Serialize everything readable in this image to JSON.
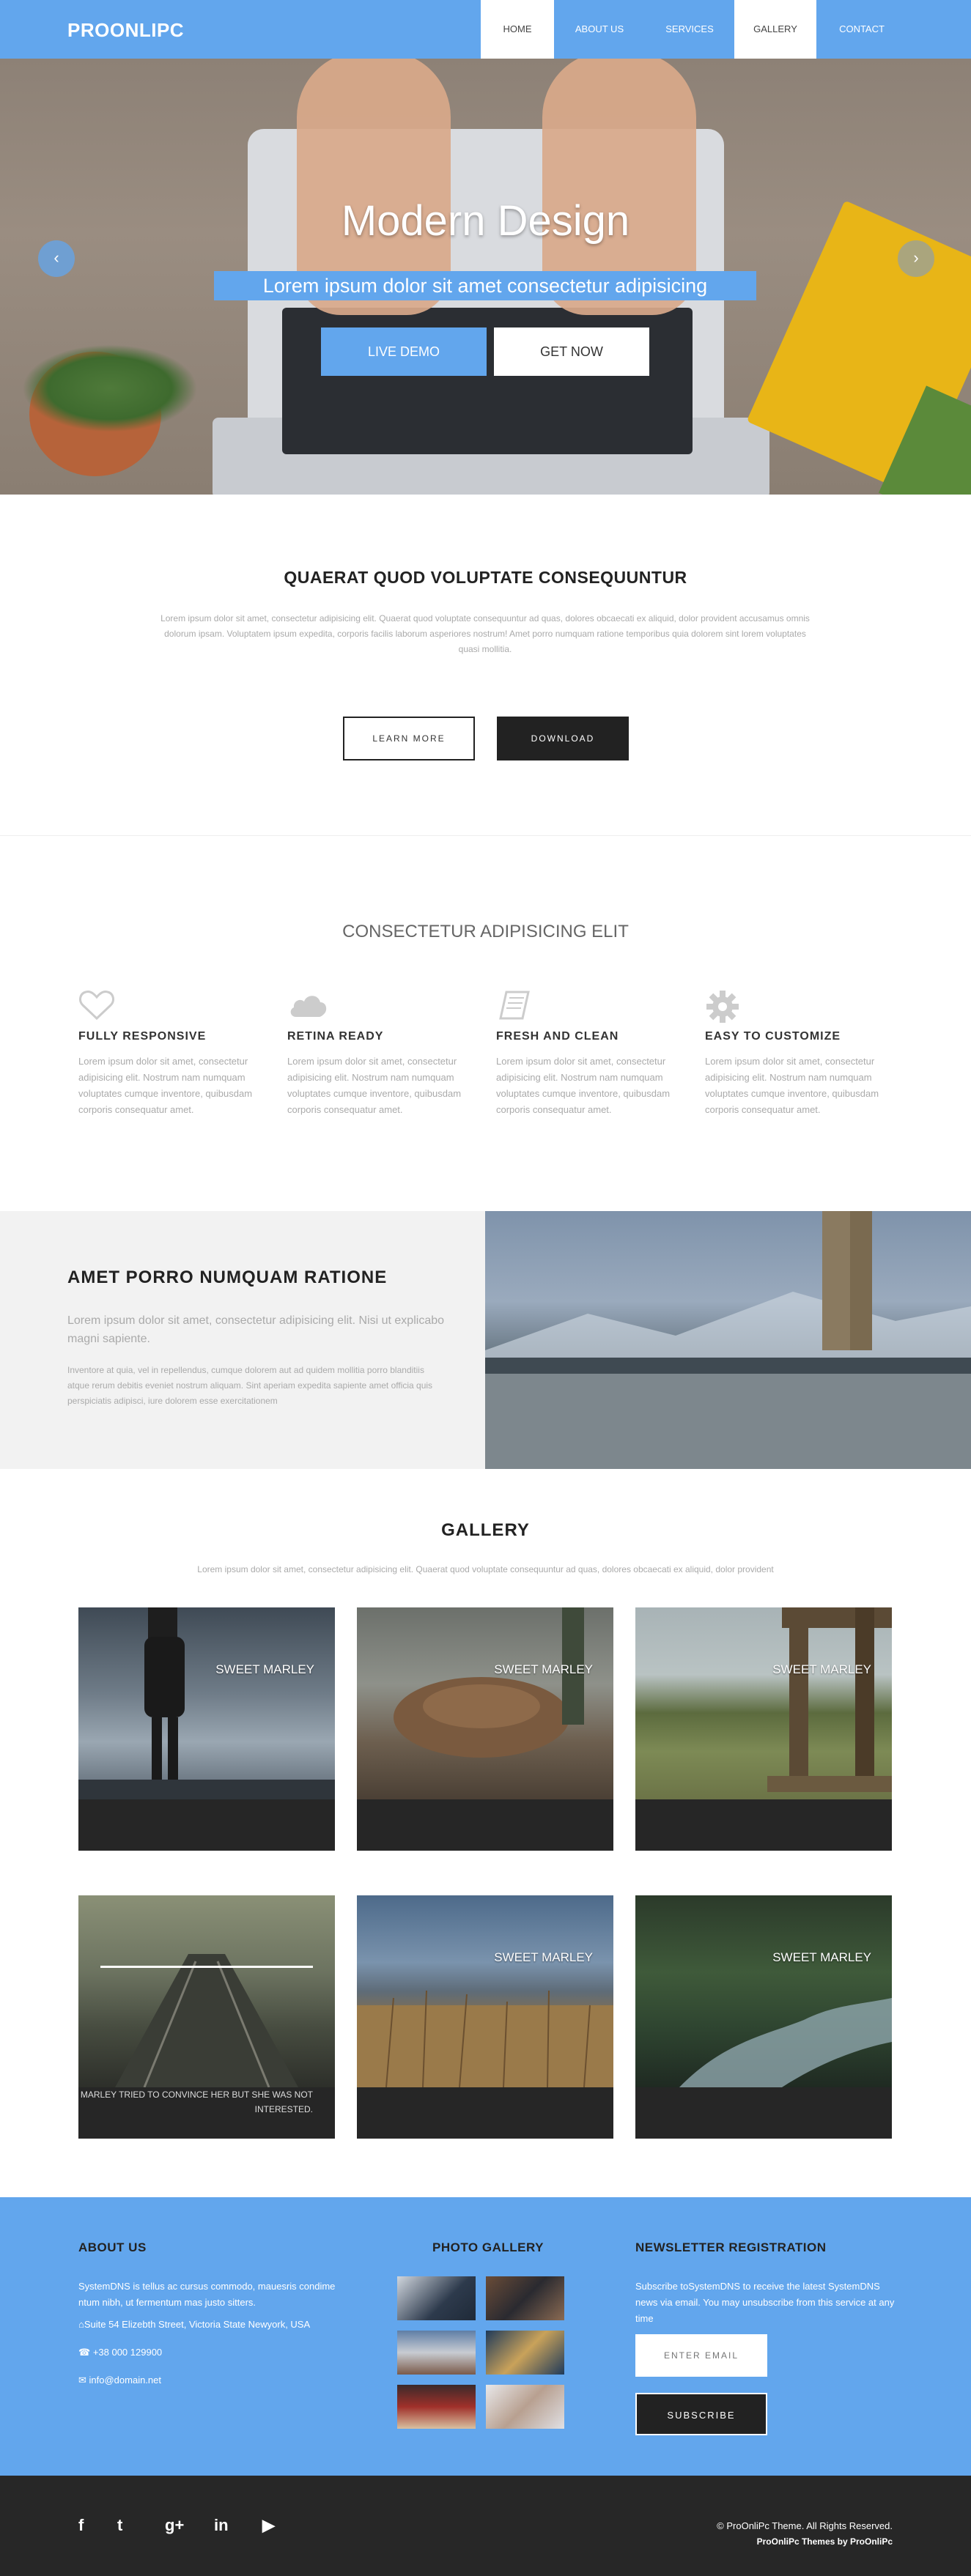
{
  "nav": {
    "brand": "PROONLIPC",
    "items": [
      {
        "label": "HOME"
      },
      {
        "label": "ABOUT US"
      },
      {
        "label": "SERVICES"
      },
      {
        "label": "GALLERY"
      },
      {
        "label": "CONTACT"
      }
    ],
    "active_item": "GALLERY"
  },
  "hero": {
    "title": "Modern Design",
    "subtitle": "Lorem ipsum dolor sit amet consectetur adipisicing",
    "live_demo": "LIVE DEMO",
    "get_now": "GET NOW",
    "prev_arrow": "‹",
    "next_arrow": "›"
  },
  "intro": {
    "title": "QUAERAT QUOD VOLUPTATE CONSEQUUNTUR",
    "text": "Lorem ipsum dolor sit amet, consectetur adipisicing elit. Quaerat quod voluptate consequuntur ad quas, dolores obcaecati ex aliquid, dolor provident accusamus omnis dolorum ipsam. Voluptatem ipsum expedita, corporis facilis laborum asperiores nostrum! Amet porro numquam ratione temporibus quia dolorem sint lorem voluptates quasi mollitia.",
    "learn_more": "LEARN MORE",
    "download": "DOWNLOAD"
  },
  "features": {
    "title": "CONSECTETUR ADIPISICING ELIT",
    "items": [
      {
        "icon": "heart-icon",
        "title": "FULLY RESPONSIVE",
        "text": "Lorem ipsum dolor sit amet, consectetur adipisicing elit. Nostrum nam numquam voluptates cumque inventore, quibusdam corporis consequatur amet."
      },
      {
        "icon": "cloud-icon",
        "title": "RETINA READY",
        "text": "Lorem ipsum dolor sit amet, consectetur adipisicing elit. Nostrum nam numquam voluptates cumque inventore, quibusdam corporis consequatur amet."
      },
      {
        "icon": "book-icon",
        "title": "FRESH AND CLEAN",
        "text": "Lorem ipsum dolor sit amet, consectetur adipisicing elit. Nostrum nam numquam voluptates cumque inventore, quibusdam corporis consequatur amet."
      },
      {
        "icon": "gear-icon",
        "title": "EASY TO CUSTOMIZE",
        "text": "Lorem ipsum dolor sit amet, consectetur adipisicing elit. Nostrum nam numquam voluptates cumque inventore, quibusdam corporis consequatur amet."
      }
    ]
  },
  "split": {
    "title": "AMET PORRO NUMQUAM RATIONE",
    "lead": "Lorem ipsum dolor sit amet, consectetur adipisicing elit. Nisi ut explicabo magni sapiente.",
    "text": "Inventore at quia, vel in repellendus, cumque dolorem aut ad quidem mollitia porro blanditiis atque rerum debitis eveniet nostrum aliquam. Sint aperiam expedita sapiente amet officia quis perspiciatis adipisci, iure dolorem esse exercitationem"
  },
  "gallery": {
    "title": "GALLERY",
    "subtitle": "Lorem ipsum dolor sit amet, consectetur adipisicing elit. Quaerat quod voluptate consequuntur ad quas, dolores obcaecati ex aliquid, dolor provident",
    "items": [
      {
        "label": "SWEET MARLEY"
      },
      {
        "label": "SWEET MARLEY"
      },
      {
        "label": "SWEET MARLEY"
      },
      {
        "label": "",
        "caption": "MARLEY TRIED TO CONVINCE HER BUT SHE WAS NOT INTERESTED."
      },
      {
        "label": "SWEET MARLEY"
      },
      {
        "label": "SWEET MARLEY"
      }
    ]
  },
  "footer": {
    "about": {
      "title": "ABOUT US",
      "text": "SystemDNS is tellus ac cursus commodo, mauesris condime ntum nibh, ut fermentum mas justo sitters.",
      "address": "Suite 54 Elizebth Street, Victoria State Newyork, USA",
      "phone": "+38 000 129900",
      "email": "info@domain.net"
    },
    "photo_gallery": {
      "title": "PHOTO GALLERY"
    },
    "newsletter": {
      "title": "NEWSLETTER REGISTRATION",
      "text": "Subscribe toSystemDNS to receive the latest SystemDNS news via email. You may unsubscribe from this service at any time",
      "placeholder": "ENTER EMAIL",
      "button": "SUBSCRIBE"
    }
  },
  "bottombar": {
    "social": [
      {
        "icon": "facebook-icon",
        "glyph": "f"
      },
      {
        "icon": "twitter-icon",
        "glyph": "t"
      },
      {
        "icon": "google-plus-icon",
        "glyph": "g+"
      },
      {
        "icon": "linkedin-icon",
        "glyph": "in"
      },
      {
        "icon": "youtube-icon",
        "glyph": "▶"
      }
    ],
    "copyright": "© ProOnliPc Theme. All Rights Reserved.",
    "credit": "ProOnliPc Themes by ProOnliPc"
  }
}
